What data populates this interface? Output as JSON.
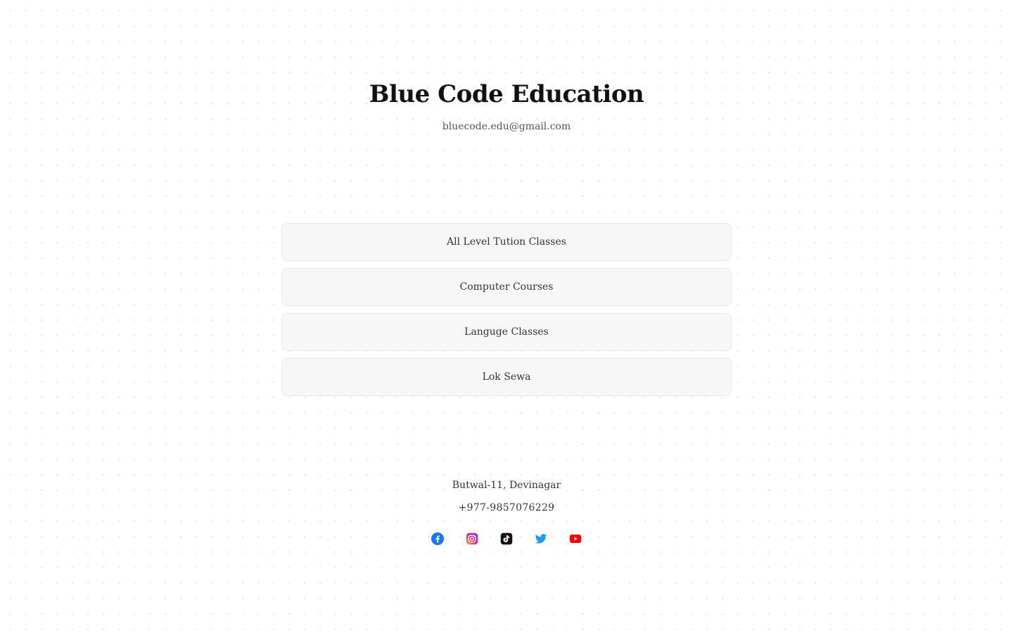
{
  "profile": {
    "name": "Blue Code Education",
    "email": "bluecode.edu@gmail.com"
  },
  "links": [
    {
      "label": "All Level Tution Classes"
    },
    {
      "label": "Computer Courses"
    },
    {
      "label": "Languge Classes"
    },
    {
      "label": "Lok Sewa"
    }
  ],
  "footer": {
    "address": "Butwal-11, Devinagar",
    "phone": "+977-9857076229"
  },
  "social": [
    {
      "icon": "facebook-icon",
      "color": "#1877f2"
    },
    {
      "icon": "instagram-icon",
      "color": "#d6249f"
    },
    {
      "icon": "tiktok-icon",
      "color": "#111111"
    },
    {
      "icon": "twitter-icon",
      "color": "#1d9bf0"
    },
    {
      "icon": "youtube-icon",
      "color": "#ff0000"
    }
  ]
}
